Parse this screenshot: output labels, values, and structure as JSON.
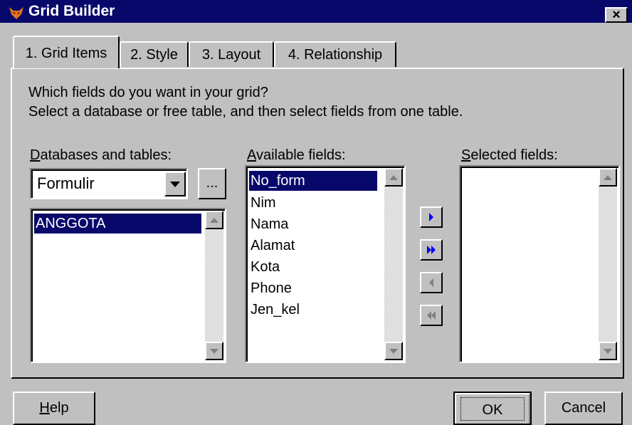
{
  "window": {
    "title": "Grid Builder",
    "close_label": "×"
  },
  "tabs": [
    {
      "label": "1. Grid Items"
    },
    {
      "label": "2. Style"
    },
    {
      "label": "3. Layout"
    },
    {
      "label": "4. Relationship"
    }
  ],
  "instructions": {
    "line1": "Which fields do you want in your grid?",
    "line2": "Select a database or free table, and then select fields from one table."
  },
  "databases": {
    "label_first": "D",
    "label_rest": "atabases and tables:",
    "selected": "Formulir",
    "browse_label": "...",
    "tables": [
      "ANGGOTA"
    ]
  },
  "available": {
    "label_first": "A",
    "label_rest": "vailable fields:",
    "fields": [
      "No_form",
      "Nim",
      "Nama",
      "Alamat",
      "Kota",
      "Phone",
      "Jen_kel"
    ]
  },
  "selected_fields": {
    "label_first": "S",
    "label_rest": "elected fields:",
    "fields": []
  },
  "footer": {
    "help_first": "H",
    "help_rest": "elp",
    "ok_label": "OK",
    "cancel_label": "Cancel"
  },
  "colors": {
    "titlebar": "#08086b",
    "face": "#c0c0c0",
    "selection": "#08086b",
    "arrow_active": "#0000ff"
  }
}
